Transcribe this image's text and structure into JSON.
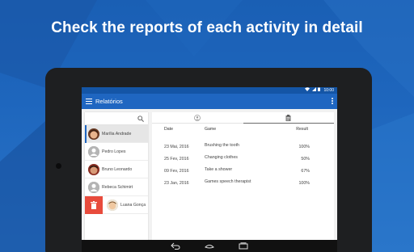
{
  "headline": "Check the reports of each activity in detail",
  "colors": {
    "accent": "#1f66c1",
    "status_bar": "#1455a6",
    "delete": "#e84b3c",
    "background": "#1e66bd"
  },
  "statusbar": {
    "time": "10:00",
    "icons": [
      "wifi-icon",
      "signal-icon",
      "battery-icon"
    ]
  },
  "appbar": {
    "title": "Relatórios",
    "menu_icon": "hamburger-menu-icon",
    "overflow_icon": "more-vert-icon"
  },
  "search": {
    "icon": "search-icon"
  },
  "students": [
    {
      "name": "Marília Andrade",
      "selected": true
    },
    {
      "name": "Pedro Lopes"
    },
    {
      "name": "Bruno Leonardo"
    },
    {
      "name": "Rebeca Schimirt"
    },
    {
      "name": "Luana Gonça",
      "swiped": true
    }
  ],
  "tabs": [
    {
      "icon": "person-icon",
      "active": false
    },
    {
      "icon": "clipboard-icon",
      "active": true
    }
  ],
  "table": {
    "headers": {
      "date": "Date",
      "game": "Game",
      "result": "Result"
    },
    "rows": [
      {
        "date": "23 Mai, 2016",
        "game": "Brushing the tooth",
        "result": "100%"
      },
      {
        "date": "25 Fev, 2016",
        "game": "Changing clothes",
        "result": "50%"
      },
      {
        "date": "09 Fev, 2016",
        "game": "Take a shower",
        "result": "67%"
      },
      {
        "date": "23 Jan, 2016",
        "game": "Games speech therapist",
        "result": "100%"
      }
    ]
  },
  "navbar": {
    "icons": [
      "back-icon",
      "home-icon",
      "recents-icon"
    ]
  }
}
